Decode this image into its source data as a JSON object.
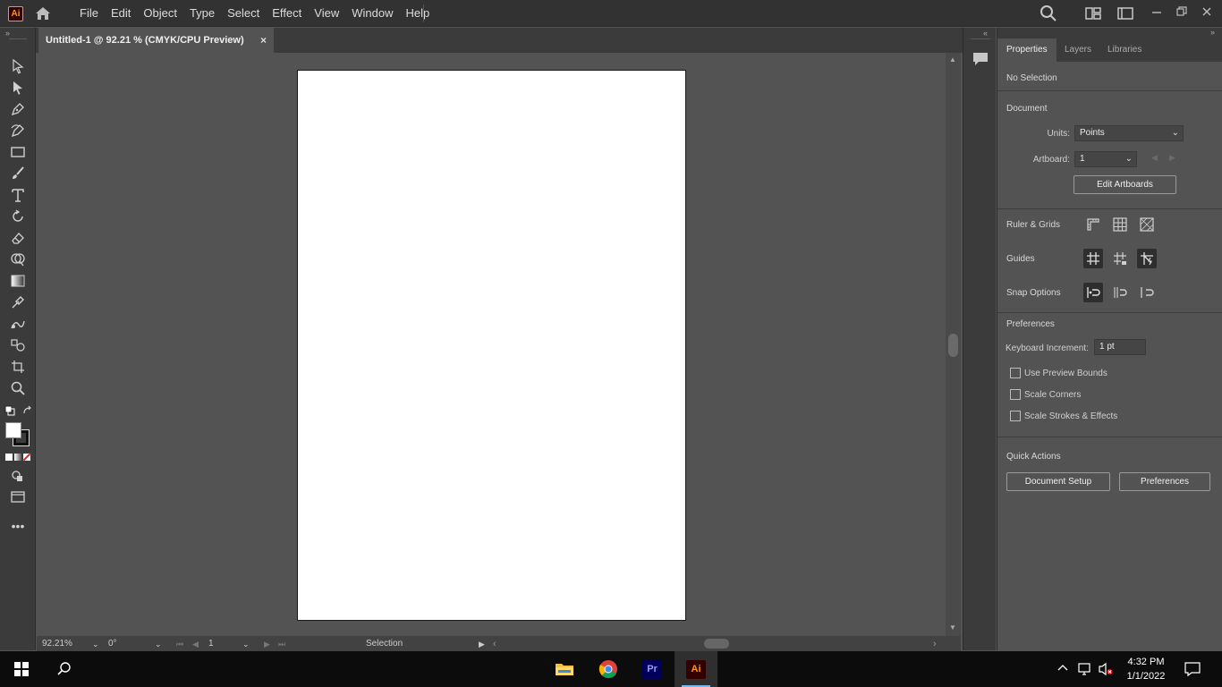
{
  "app": {
    "logo_text": "Ai"
  },
  "menu": [
    "File",
    "Edit",
    "Object",
    "Type",
    "Select",
    "Effect",
    "View",
    "Window",
    "Help"
  ],
  "document_tab": {
    "title": "Untitled-1 @ 92.21 % (CMYK/CPU Preview)",
    "close": "×"
  },
  "statusbar": {
    "zoom": "92.21%",
    "rotation": "0°",
    "artboard_number": "1",
    "tool_name": "Selection"
  },
  "panel": {
    "tabs": [
      "Properties",
      "Layers",
      "Libraries"
    ],
    "selection_status": "No Selection",
    "document_section": "Document",
    "units_label": "Units:",
    "units_value": "Points",
    "artboard_label": "Artboard:",
    "artboard_value": "1",
    "edit_artboards": "Edit Artboards",
    "ruler_grids": "Ruler & Grids",
    "guides": "Guides",
    "snap_options": "Snap Options",
    "preferences_section": "Preferences",
    "keyboard_increment_label": "Keyboard Increment:",
    "keyboard_increment_value": "1 pt",
    "use_preview_bounds": "Use Preview Bounds",
    "scale_corners": "Scale Corners",
    "scale_strokes_effects": "Scale Strokes & Effects",
    "quick_actions": "Quick Actions",
    "document_setup": "Document Setup",
    "preferences_button": "Preferences"
  },
  "taskbar": {
    "time": "4:32 PM",
    "date": "1/1/2022",
    "premiere_label": "Pr",
    "illustrator_label": "Ai"
  }
}
